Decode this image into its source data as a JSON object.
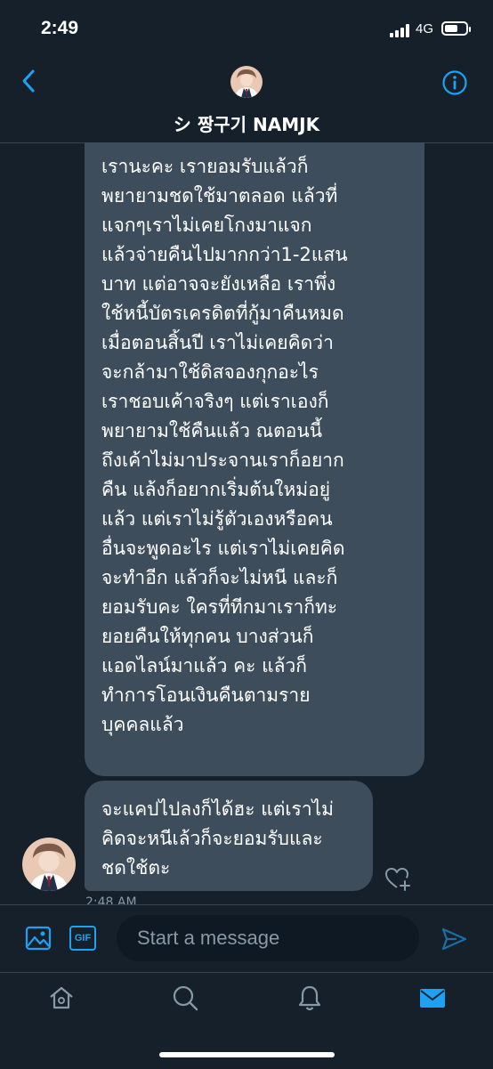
{
  "status": {
    "time": "2:49",
    "network": "4G"
  },
  "header": {
    "name": "シ 짱구기 NAMJK"
  },
  "messages": [
    {
      "lines": [
        "เรานะคะ เรายอมรับแล้วก็",
        "พยายามชดใช้มาตลอด แล้วที่",
        "แจกๆเราไม่เคยโกงมาแจก",
        "แล้วจ่ายคืนไปมากกว่า1-2แสน",
        "บาท แต่อาจจะยังเหลือ เราพึ่ง",
        "ใช้หนี้บัตรเครดิตที่กู้มาคืนหมด",
        "เมื่อตอนสิ้นปี เราไม่เคยคิดว่า",
        "จะกล้ามาใช้ดิสจองกุกอะไร",
        "เราชอบเค้าจริงๆ แต่เราเองก็",
        "พยายามใช้คืนแล้ว ณตอนนี้",
        "ถึงเค้าไม่มาประจานเราก็อยาก",
        "คืน แล้งก็อยากเริ่มต้นใหม่อยู่",
        "แล้ว แต่เราไม่รู้ตัวเองหรือคน",
        "อื่นจะพูดอะไร แต่เราไม่เคยคิด",
        "จะทำอีก แล้วก็จะไม่หนี และก็",
        "ยอมรับคะ ใครที่ทีกมาเราก็ทะ",
        "ยอยคืนให้ทุกคน บางส่วนก็",
        "แอดไลน์มาแล้ว คะ แล้วก็",
        "ทำการโอนเงินคืนตามราย",
        "บุคคลแล้ว"
      ]
    },
    {
      "lines": [
        "จะแคปไปลงก็ได้ฮะ แต่เราไม่",
        "คิดจะหนีเล้วก็จะยอมรับและ",
        "ชดใช้ตะ"
      ]
    }
  ],
  "timestamp": "2:48 AM",
  "composer": {
    "placeholder": "Start a message",
    "gif_label": "GIF"
  },
  "icons": {
    "back": "chevron-left-icon",
    "info": "info-icon",
    "media": "image-icon",
    "send": "send-icon",
    "like": "heart-plus-icon",
    "tabs": [
      "home-icon",
      "search-icon",
      "bell-icon",
      "mail-icon"
    ]
  },
  "colors": {
    "accent": "#1da1f2",
    "background": "#15202b",
    "bubble": "#3d4d5c",
    "divider": "#38444d",
    "muted": "#8899a6"
  }
}
